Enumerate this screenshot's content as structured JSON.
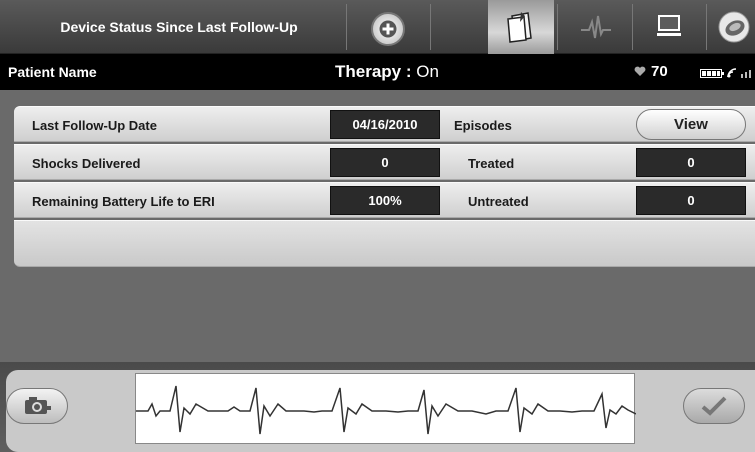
{
  "top_bar": {
    "title": "Device Status Since Last Follow-Up",
    "tabs": [
      {
        "icon": "status-report-icon",
        "active": true
      },
      {
        "icon": "ecg-trace-icon",
        "active": false
      },
      {
        "icon": "computer-monitor-icon",
        "active": false
      },
      {
        "icon": "wand-telemetry-icon",
        "active": false
      }
    ]
  },
  "header": {
    "patient_name": "Patient Name",
    "therapy_label": "Therapy : ",
    "therapy_value": "On",
    "heart_rate": "70"
  },
  "rows": [
    {
      "label": "Last Follow-Up Date",
      "value": "04/16/2010",
      "sublabel": "Episodes",
      "button": "View"
    },
    {
      "label": "Shocks Delivered",
      "value": "0",
      "sublabel": "Treated",
      "subvalue": "0"
    },
    {
      "label": "Remaining Battery Life to ERI",
      "value": "100%",
      "sublabel": "Untreated",
      "subvalue": "0"
    }
  ],
  "colors": {
    "header_bg": "#000000",
    "value_box": "#2a2a2a",
    "active_tab": "#d8d8d8"
  }
}
